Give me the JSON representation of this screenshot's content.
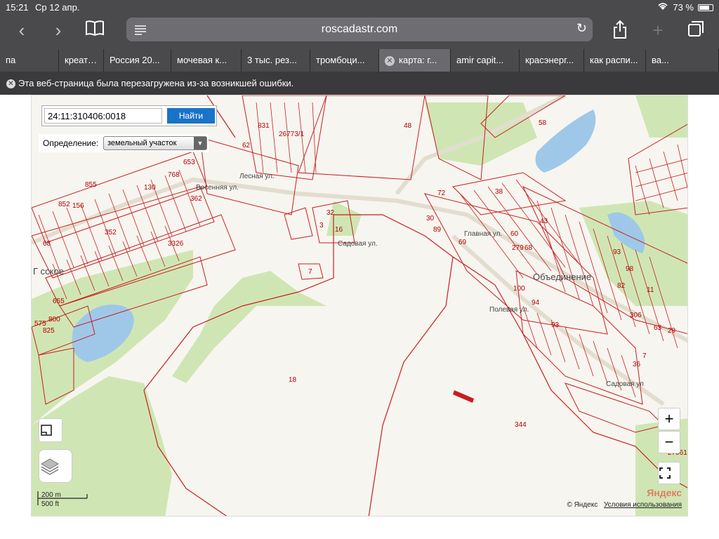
{
  "status_bar": {
    "time": "15:21",
    "date": "Ср 12 апр.",
    "battery": "73 %"
  },
  "toolbar": {
    "url": "roscadastr.com"
  },
  "tabs": [
    {
      "label": "па"
    },
    {
      "label": "креатин"
    },
    {
      "label": "Россия 20..."
    },
    {
      "label": "мочевая к..."
    },
    {
      "label": "3 тыс. рез..."
    },
    {
      "label": "тромбоци..."
    },
    {
      "label": "карта: г...",
      "active": true
    },
    {
      "label": "amir capit..."
    },
    {
      "label": "красэнерг..."
    },
    {
      "label": "как распи..."
    },
    {
      "label": "ва..."
    }
  ],
  "notice": {
    "text": "Эта веб-страница была перезагружена из-за возникшей ошибки."
  },
  "search": {
    "value": "24:11:310406:0018",
    "button": "Найти"
  },
  "definition": {
    "label": "Определение:",
    "selected": "земельный участок"
  },
  "map": {
    "places": [
      "Г сское",
      "Объединение"
    ],
    "streets": [
      "Садовая ул.",
      "Главная ул.",
      "Полевая ул.",
      "Лесная ул.",
      "Весенняя ул.",
      "Садовая ул"
    ],
    "parcel_labels": [
      "48",
      "58",
      "18",
      "344",
      "72",
      "38",
      "30",
      "89",
      "69",
      "60",
      "279",
      "68",
      "43",
      "93",
      "98",
      "82",
      "11",
      "306",
      "63",
      "29",
      "36",
      "7",
      "100",
      "94",
      "93",
      "16",
      "32",
      "3",
      "7",
      "855",
      "852",
      "156",
      "352",
      "130",
      "768",
      "653",
      "362",
      "62",
      "831",
      "26773/1",
      "68",
      "655",
      "575",
      "825",
      "800",
      "3326",
      "27061"
    ],
    "zoom_in": "+",
    "zoom_out": "−",
    "scale_metric": "200 m",
    "scale_imperial": "500 ft",
    "attribution": "© Яндекс",
    "terms": "Условия использования",
    "logo": "Яндекс"
  }
}
